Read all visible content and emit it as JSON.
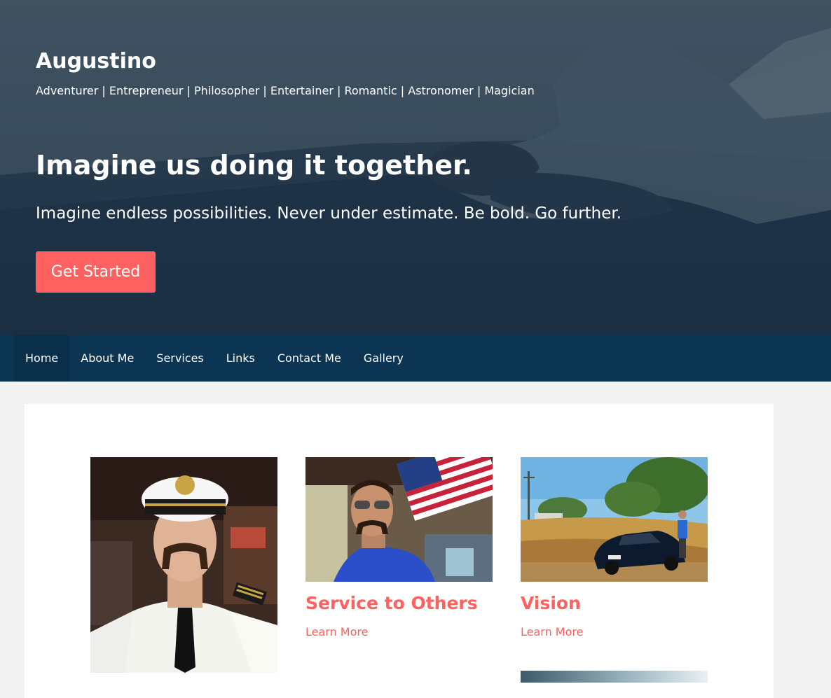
{
  "site": {
    "title": "Augustino",
    "tagline": "Adventurer | Entrepreneur | Philosopher | Entertainer | Romantic | Astronomer | Magician"
  },
  "hero": {
    "heading": "Imagine us doing it together.",
    "subheading": "Imagine endless possibilities. Never under estimate. Be bold. Go further.",
    "cta_label": "Get Started"
  },
  "nav": {
    "items": [
      {
        "label": "Home",
        "active": true
      },
      {
        "label": "About Me"
      },
      {
        "label": "Services"
      },
      {
        "label": "Links"
      },
      {
        "label": "Contact Me"
      },
      {
        "label": "Gallery"
      }
    ]
  },
  "features": [
    {
      "title": "Service to Others",
      "link_label": "Learn More"
    },
    {
      "title": "Vision",
      "link_label": "Learn More"
    }
  ],
  "colors": {
    "accent": "#ff6161",
    "nav_background": "#0b3553",
    "page_background": "#f3f3f3"
  }
}
